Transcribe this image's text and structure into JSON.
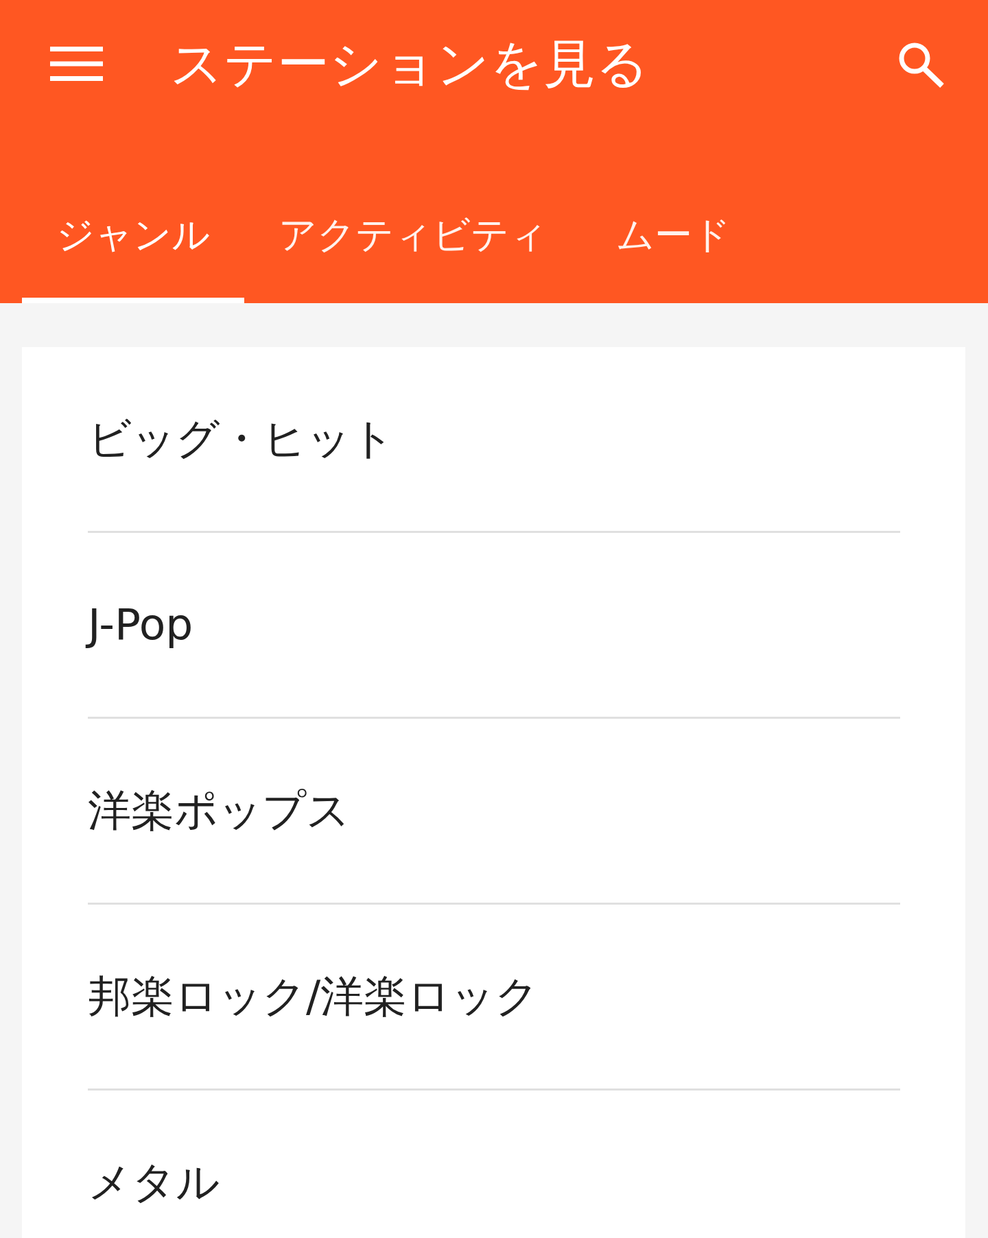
{
  "app_bar": {
    "title": "ステーションを見る"
  },
  "tabs": [
    {
      "label": "ジャンル",
      "selected": true
    },
    {
      "label": "アクティビティ",
      "selected": false
    },
    {
      "label": "ムード",
      "selected": false
    }
  ],
  "genres": [
    {
      "label": "ビッグ・ヒット"
    },
    {
      "label": "J-Pop"
    },
    {
      "label": "洋楽ポップス"
    },
    {
      "label": "邦楽ロック/洋楽ロック"
    },
    {
      "label": "メタル"
    }
  ]
}
